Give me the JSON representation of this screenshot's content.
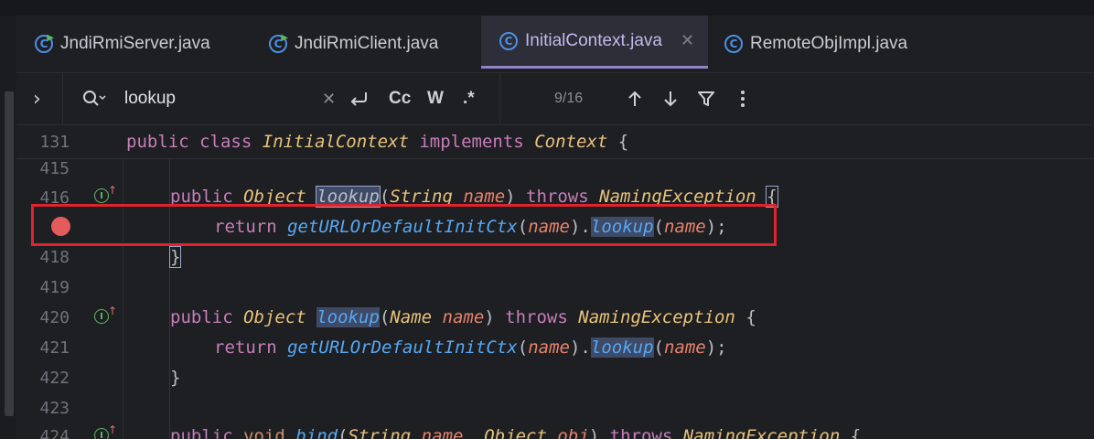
{
  "tabs": [
    {
      "label": "JndiRmiServer.java",
      "icon": "java-class-runnable-icon"
    },
    {
      "label": "JndiRmiClient.java",
      "icon": "java-class-runnable-icon"
    },
    {
      "label": "InitialContext.java",
      "icon": "java-class-icon",
      "active": true,
      "close": "✕"
    },
    {
      "label": "RemoteObjImpl.java",
      "icon": "java-class-icon"
    }
  ],
  "search": {
    "query": "lookup",
    "clear": "✕",
    "match_case": "Cc",
    "words": "W",
    "regex": ".*",
    "match_count": "9/16",
    "expand": "›"
  },
  "sticky": {
    "line_number": "131",
    "t1": "public",
    "t2": "class",
    "t3": "InitialContext",
    "t4": "implements",
    "t5": "Context",
    "t6": "{"
  },
  "lines": {
    "l415": "415",
    "l416": "416",
    "l418": "418",
    "l419": "419",
    "l420": "420",
    "l421": "421",
    "l422": "422",
    "l423": "423",
    "l424": "424"
  },
  "code": {
    "public": "public",
    "Object": "Object",
    "lookup": "lookup",
    "String": "String",
    "Name": "Name",
    "name": "name",
    "throws": "throws",
    "NamingException": "NamingException",
    "return": "return",
    "getURL": "getURLOrDefaultInitCtx",
    "void": "void",
    "bind": "bind",
    "obj": "obj"
  },
  "colors": {
    "accent": "#9283c9",
    "breakpoint": "#e35b5b",
    "highlight_box": "#e0232c"
  }
}
